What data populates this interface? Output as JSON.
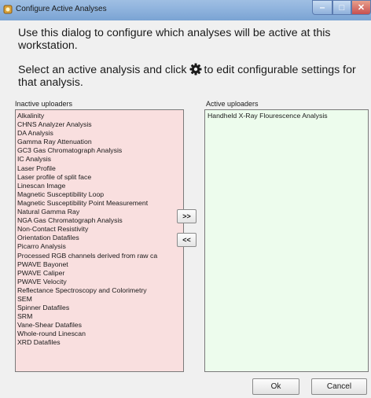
{
  "window": {
    "title": "Configure Active Analyses",
    "minimize_glyph": "‒",
    "maximize_glyph": "□",
    "close_glyph": "✕"
  },
  "intro": {
    "line1": "Use this dialog to configure which analyses will be active at this workstation.",
    "line2_before": "Select an active analysis and click",
    "line2_after": "to edit configurable settings for that analysis.",
    "icon": "gear-icon"
  },
  "inactive": {
    "label": "Inactive uploaders",
    "items": [
      "Alkalinity",
      "CHNS Analyzer Analysis",
      "DA Analysis",
      "Gamma Ray Attenuation",
      "GC3 Gas Chromatograph Analysis",
      "IC Analysis",
      "Laser Profile",
      "Laser profile of split face",
      "Linescan Image",
      "Magnetic Susceptibility Loop",
      "Magnetic Susceptibility Point Measurement",
      "Natural Gamma Ray",
      "NGA Gas Chromatograph Analysis",
      "Non-Contact Resistivity",
      "Orientation Datafiles",
      "Picarro Analysis",
      "Processed RGB channels derived from raw ca",
      "PWAVE Bayonet",
      "PWAVE Caliper",
      "PWAVE Velocity",
      "Reflectance Spectroscopy and Colorimetry",
      "SEM",
      "Spinner Datafiles",
      "SRM",
      "Vane-Shear Datafiles",
      "Whole-round Linescan",
      "XRD Datafiles"
    ]
  },
  "active": {
    "label": "Active uploaders",
    "items": [
      "Handheld X-Ray Flourescence Analysis"
    ]
  },
  "buttons": {
    "move_right": ">>",
    "move_left": "<<",
    "ok": "Ok",
    "cancel": "Cancel"
  }
}
